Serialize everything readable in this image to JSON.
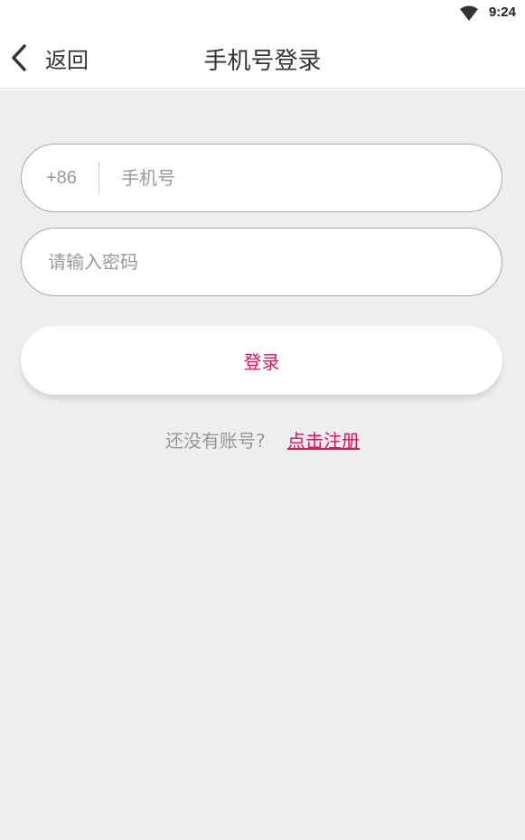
{
  "status_bar": {
    "time": "9:24",
    "wifi_icon": "wifi-icon"
  },
  "header": {
    "back_icon": "chevron-left-icon",
    "back_label": "返回",
    "title": "手机号登录"
  },
  "form": {
    "phone": {
      "prefix": "+86",
      "placeholder": "手机号",
      "value": ""
    },
    "password": {
      "placeholder": "请输入密码",
      "value": ""
    },
    "login_label": "登录"
  },
  "register": {
    "hint": "还没有账号?",
    "link_label": "点击注册"
  },
  "colors": {
    "accent": "#e0115f",
    "background": "#eeeeee",
    "surface": "#ffffff"
  }
}
